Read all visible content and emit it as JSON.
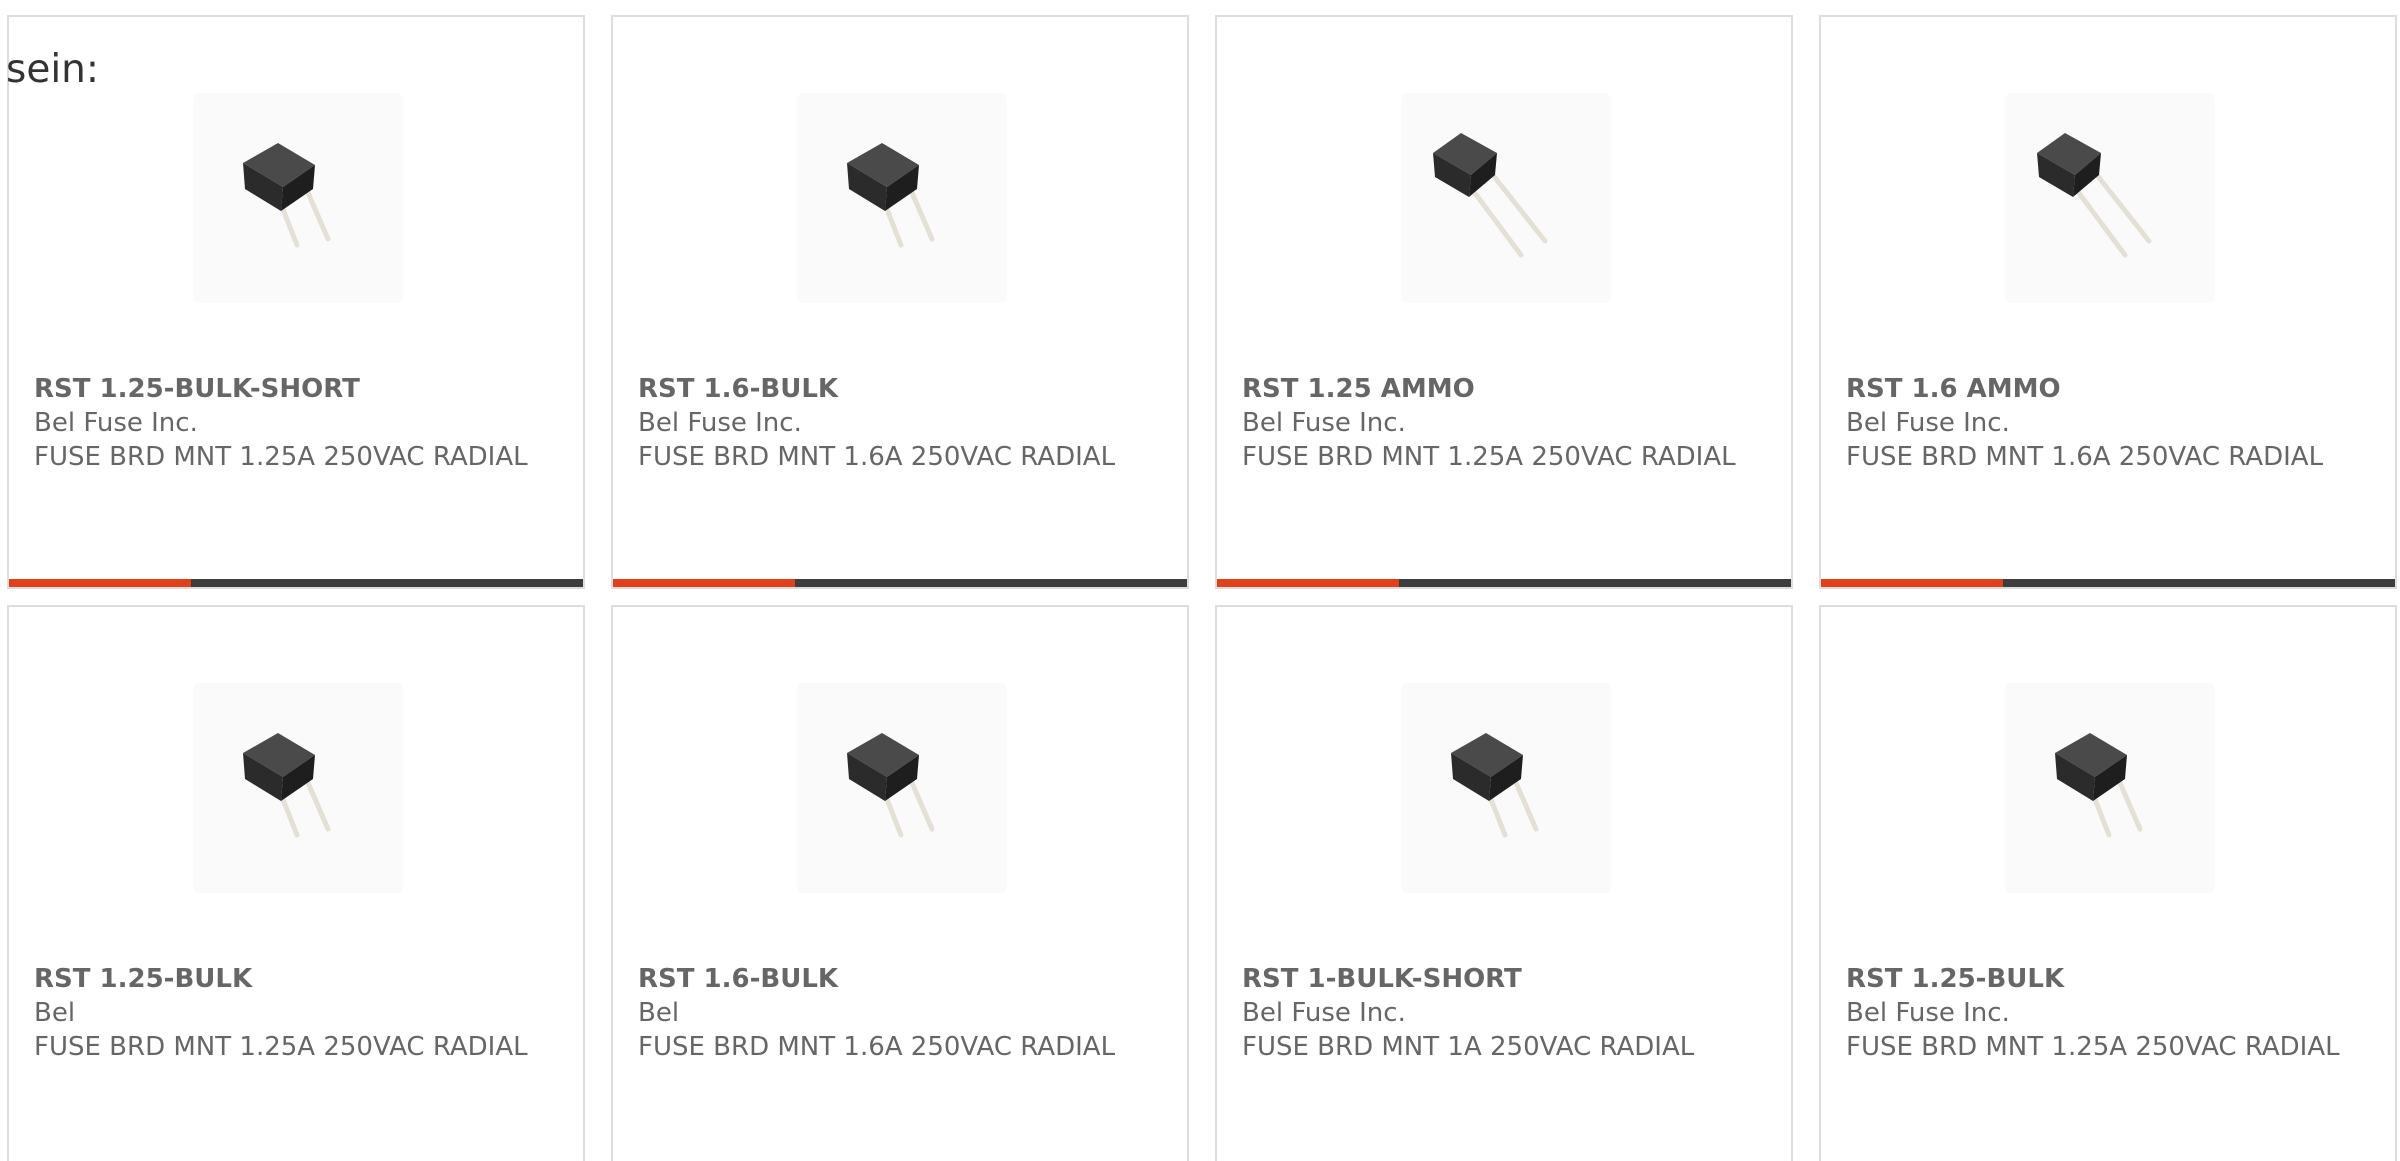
{
  "intro_text": "sein:",
  "colors": {
    "accent": "#e0401a",
    "bar_dark": "#3d3d3d",
    "text": "#666666",
    "border": "#dddddd"
  },
  "products": [
    {
      "part_number": "RST 1.25-BULK-SHORT",
      "manufacturer": "Bel Fuse Inc.",
      "description": "FUSE BRD MNT 1.25A 250VAC RADIAL",
      "image": "short-lead-fuse-icon",
      "show_bar": true
    },
    {
      "part_number": "RST 1.6-BULK",
      "manufacturer": "Bel Fuse Inc.",
      "description": "FUSE BRD MNT 1.6A 250VAC RADIAL",
      "image": "short-lead-fuse-icon",
      "show_bar": true
    },
    {
      "part_number": "RST 1.25 AMMO",
      "manufacturer": "Bel Fuse Inc.",
      "description": "FUSE BRD MNT 1.25A 250VAC RADIAL",
      "image": "long-lead-fuse-icon",
      "show_bar": true
    },
    {
      "part_number": "RST 1.6 AMMO",
      "manufacturer": "Bel Fuse Inc.",
      "description": "FUSE BRD MNT 1.6A 250VAC RADIAL",
      "image": "long-lead-fuse-icon",
      "show_bar": true
    },
    {
      "part_number": "RST 1.25-BULK",
      "manufacturer": "Bel",
      "description": "FUSE BRD MNT 1.25A 250VAC RADIAL",
      "image": "short-lead-fuse-icon",
      "show_bar": false
    },
    {
      "part_number": "RST 1.6-BULK",
      "manufacturer": "Bel",
      "description": "FUSE BRD MNT 1.6A 250VAC RADIAL",
      "image": "short-lead-fuse-icon",
      "show_bar": false
    },
    {
      "part_number": "RST 1-BULK-SHORT",
      "manufacturer": "Bel Fuse Inc.",
      "description": "FUSE BRD MNT 1A 250VAC RADIAL",
      "image": "short-lead-fuse-icon",
      "show_bar": false
    },
    {
      "part_number": "RST 1.25-BULK",
      "manufacturer": "Bel Fuse Inc.",
      "description": "FUSE BRD MNT 1.25A 250VAC RADIAL",
      "image": "short-lead-fuse-icon",
      "show_bar": false
    }
  ]
}
